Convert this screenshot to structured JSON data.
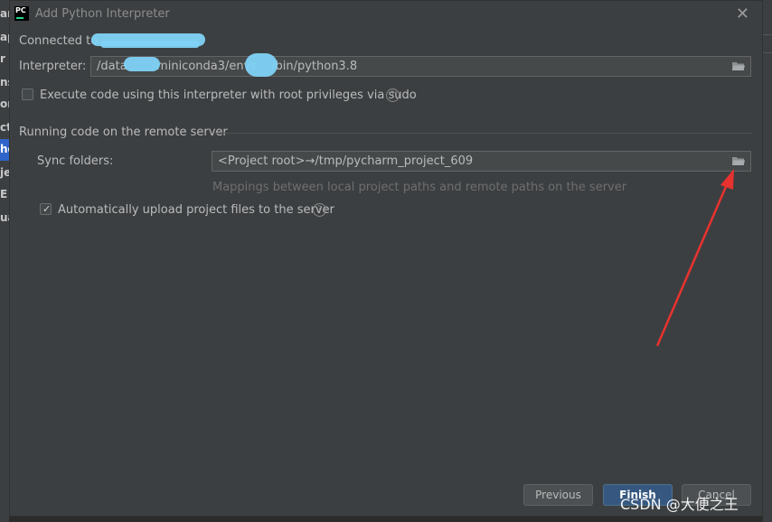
{
  "dialog": {
    "title": "Add Python Interpreter",
    "app_icon": "pycharm-logo",
    "app_icon_text": "PC"
  },
  "connection": {
    "label": "Connected to",
    "value_redacted": true
  },
  "interpreter": {
    "label": "Interpreter:",
    "path_part1": "/data",
    "path_part2": "/miniconda3/envs",
    "path_part3": "/bin/python3.8"
  },
  "sudo": {
    "label": "Execute code using this interpreter with root privileges via sudo",
    "checked": false
  },
  "remote_section": {
    "title": "Running code on the remote server",
    "sync_label": "Sync folders:",
    "sync_value": "<Project root>→/tmp/pycharm_project_609",
    "sync_hint": "Mappings between local project paths and remote paths on the server",
    "upload_label": "Automatically upload project files to the server",
    "upload_checked": true
  },
  "buttons": {
    "previous": "Previous",
    "finish": "Finish",
    "cancel": "Cancel"
  },
  "left_fragments": [
    "an",
    "ap",
    "r",
    "ns",
    "on",
    "ct",
    "ho",
    "je",
    "E",
    "ua"
  ],
  "watermark": "CSDN @大便之王",
  "colors": {
    "accent": "#365880",
    "annotation_arrow": "#e8322f",
    "redaction": "#7fd2f5"
  }
}
